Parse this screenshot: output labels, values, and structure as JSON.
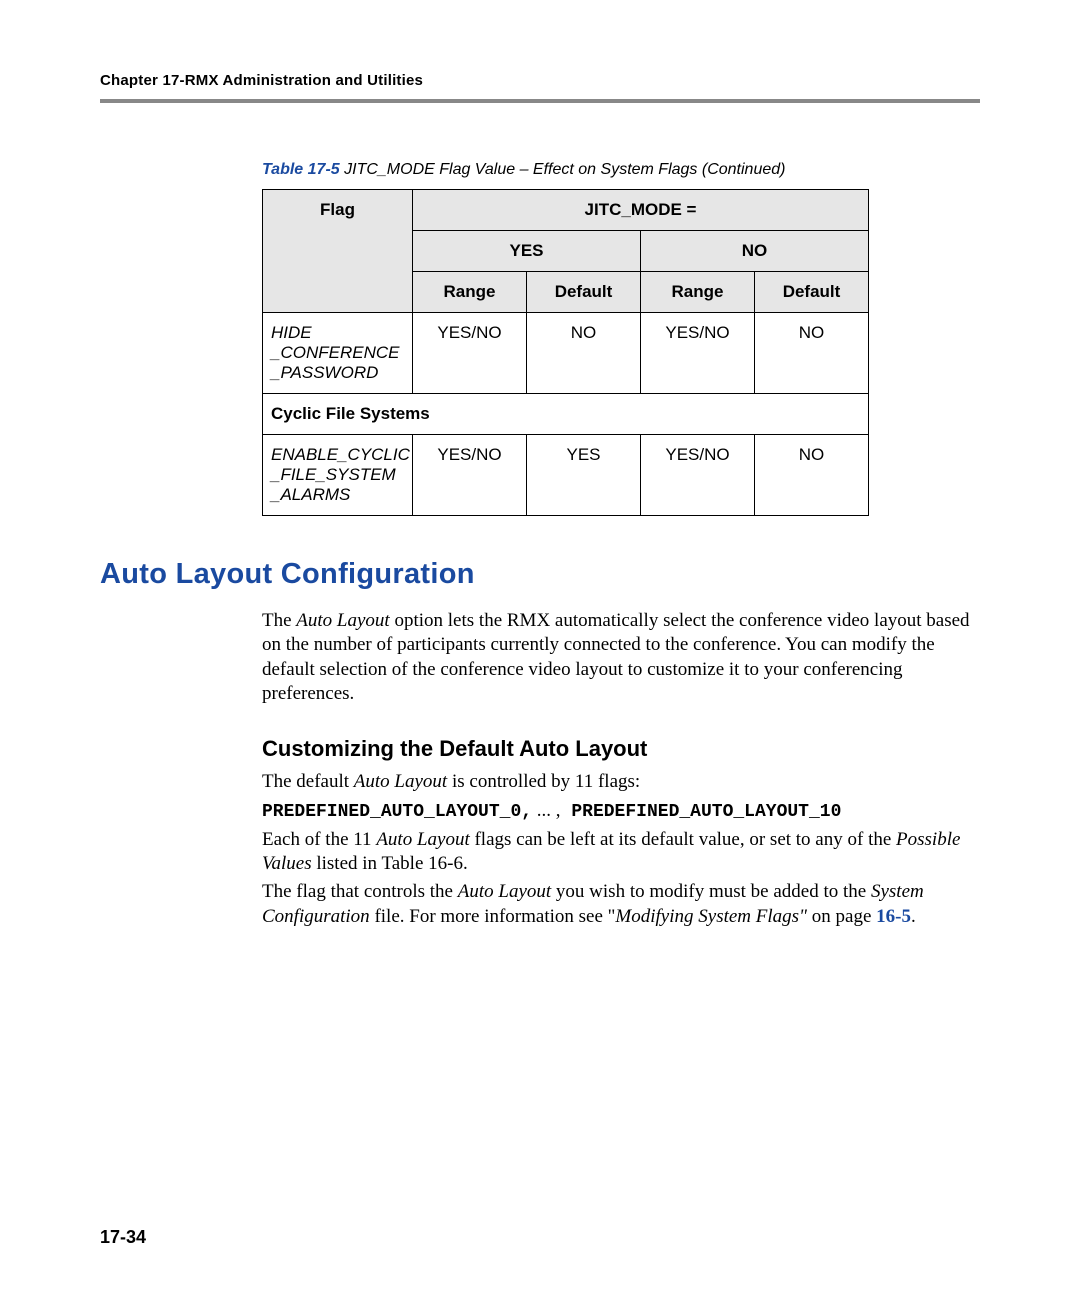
{
  "header": {
    "running_head": "Chapter 17-RMX Administration and Utilities"
  },
  "table": {
    "caption_label": "Table 17-5",
    "caption_text": " JITC_MODE Flag Value – Effect on System Flags (Continued)",
    "head": {
      "flag": "Flag",
      "jitc_mode": "JITC_MODE =",
      "yes": "YES",
      "no": "NO",
      "range": "Range",
      "default": "Default"
    },
    "rows": [
      {
        "flag_lines": [
          "HIDE",
          "_CONFERENCE",
          "_PASSWORD"
        ],
        "yes_range": "YES/NO",
        "yes_default": "NO",
        "no_range": "YES/NO",
        "no_default": "NO"
      }
    ],
    "section": "Cyclic File Systems",
    "rows2": [
      {
        "flag_lines": [
          "ENABLE_CYCLIC",
          "_FILE_SYSTEM",
          "_ALARMS"
        ],
        "yes_range": "YES/NO",
        "yes_default": "YES",
        "no_range": "YES/NO",
        "no_default": "NO"
      }
    ]
  },
  "h1": "Auto Layout Configuration",
  "p1_a": "The ",
  "p1_em1": "Auto Layout",
  "p1_b": " option lets the RMX automatically select the conference video layout based on the number of participants currently connected to the conference. You can modify the default selection of the conference video layout to customize it to your conferencing preferences.",
  "h2": "Customizing the Default Auto Layout",
  "p2_a": "The default ",
  "p2_em1": "Auto Layout",
  "p2_b": " is controlled by 11 flags:",
  "p3_mono_a": "PREDEFINED_AUTO_LAYOUT_0,",
  "p3_mid": " ... ,",
  "p3_mono_b": " PREDEFINED_AUTO_LAYOUT_10",
  "p4_a": "Each of the 11 ",
  "p4_em1": "Auto Layout",
  "p4_b": " flags can be left at its default value, or set to any of the ",
  "p4_em2": "Possible Values",
  "p4_c": " listed in Table 16-6.",
  "p5_a": "The flag that controls the ",
  "p5_em1": "Auto Layout",
  "p5_b": " you wish to modify must be added to the ",
  "p5_em2": "System Configuration",
  "p5_c": " file. For more information see \"",
  "p5_em3": "Modifying System Flags\"",
  "p5_d": " on page ",
  "p5_xref": "16-5",
  "p5_e": ".",
  "page_number": "17-34"
}
